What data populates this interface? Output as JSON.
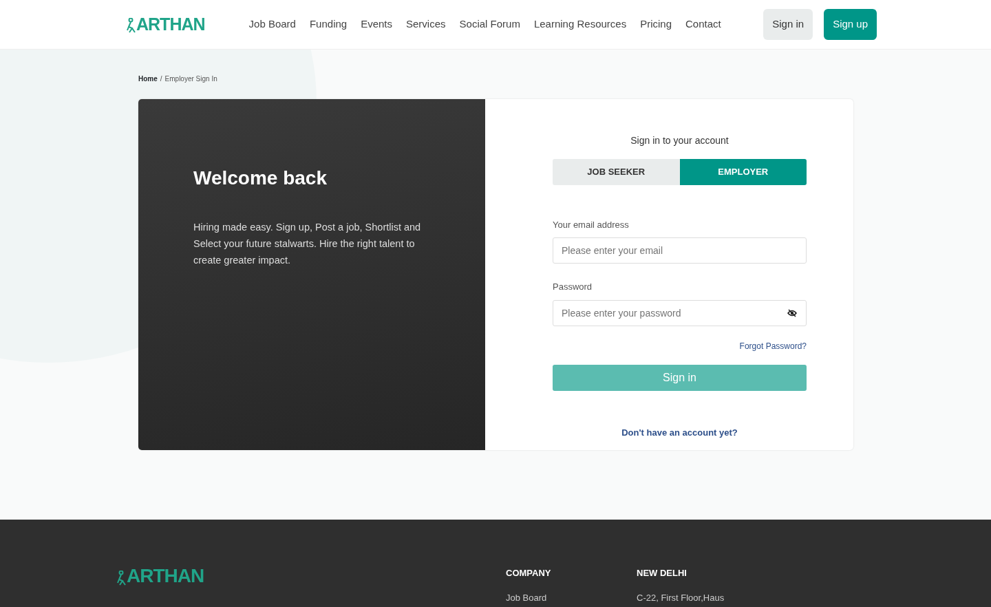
{
  "header": {
    "logo": "ARTHAN",
    "nav": [
      "Job Board",
      "Funding",
      "Events",
      "Services",
      "Social Forum",
      "Learning Resources",
      "Pricing",
      "Contact"
    ],
    "sign_in": "Sign in",
    "sign_up": "Sign up"
  },
  "breadcrumb": {
    "separator": "/",
    "items": [
      {
        "label": "Home",
        "current": false
      },
      {
        "label": "Employer Sign In",
        "current": true
      }
    ]
  },
  "welcome": {
    "title": "Welcome back",
    "text": "Hiring made easy. Sign up, Post a job, Shortlist and Select your future stalwarts. Hire the right talent to create greater impact."
  },
  "form": {
    "heading": "Sign in to your account",
    "tabs": [
      {
        "label": "JOB SEEKER",
        "selected": false
      },
      {
        "label": "EMPLOYER",
        "selected": true
      }
    ],
    "email": {
      "label": "Your email address",
      "placeholder": "Please enter your email"
    },
    "password": {
      "label": "Password",
      "placeholder": "Please enter your password"
    },
    "forgot": "Forgot Password?",
    "submit": "Sign in",
    "disabled": true,
    "signup_link": "Don't have an account yet?"
  },
  "footer": {
    "logo": "ARTHAN",
    "columns": [
      {
        "heading": "COMPANY",
        "items": [
          "Job Board"
        ]
      },
      {
        "heading": "NEW DELHI",
        "items": [
          "C-22, First Floor,Haus"
        ]
      }
    ]
  }
}
